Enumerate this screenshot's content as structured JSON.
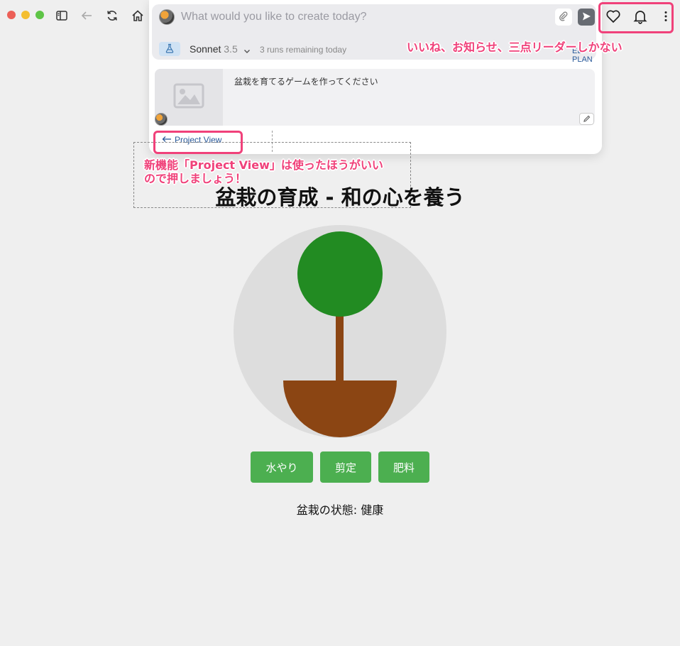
{
  "prompt": {
    "placeholder": "What would you like to create today?",
    "model_name": "Sonnet",
    "model_version": "3.5",
    "runs_remaining": "3 runs remaining today",
    "plan_link": "EE PLAN"
  },
  "history": {
    "message": "盆栽を育てるゲームを作ってください",
    "project_view": "Project View"
  },
  "annotations": {
    "icons_note": "いいね、お知らせ、三点リーダーしかない",
    "project_view_note_line1": "新機能「Project View」は使ったほうがいい",
    "project_view_note_line2": "ので押しましょう！"
  },
  "game": {
    "title": "盆栽の育成 - 和の心を養う",
    "buttons": {
      "water": "水やり",
      "prune": "剪定",
      "fertilize": "肥料"
    },
    "status_label": "盆栽の状態:",
    "status_value": "健康",
    "colors": {
      "foliage": "#228b22",
      "trunk": "#8b4513",
      "pot": "#8b4513",
      "background_circle": "#dddddd",
      "button": "#4caf50"
    }
  },
  "colors": {
    "annotation": "#f0417a"
  },
  "icons": {
    "browser": [
      "sidebar-icon",
      "back-arrow-icon",
      "reload-icon",
      "home-icon"
    ],
    "toolbar_right": [
      "heart-icon",
      "bell-icon",
      "more-vertical-icon"
    ]
  }
}
